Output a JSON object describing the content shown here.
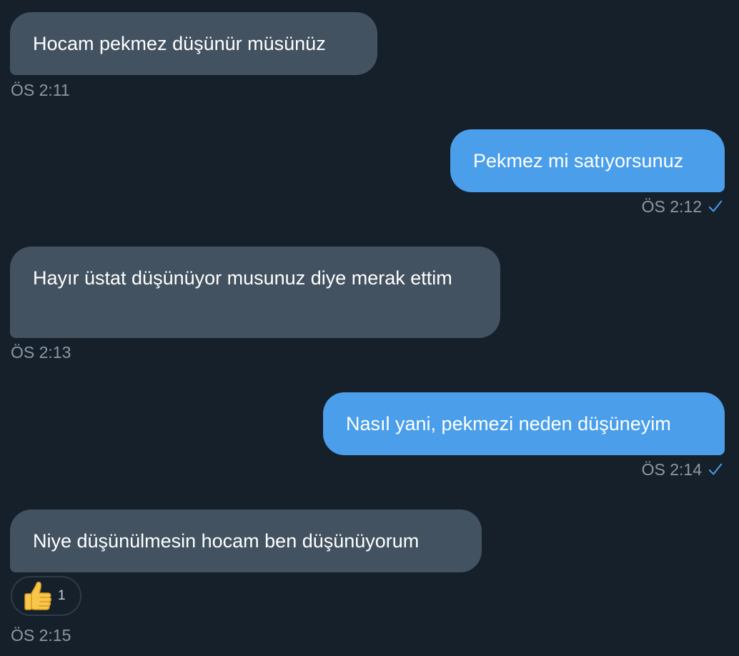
{
  "messages": [
    {
      "direction": "incoming",
      "text": "Hocam pekmez düşünür müsünüz",
      "time": "ÖS 2:11"
    },
    {
      "direction": "outgoing",
      "text": "Pekmez mi satıyorsunuz",
      "time": "ÖS 2:12",
      "status_icon": "check-icon"
    },
    {
      "direction": "incoming",
      "text": "Hayır üstat düşünüyor musunuz diye merak ettim",
      "time": "ÖS 2:13"
    },
    {
      "direction": "outgoing",
      "text": "Nasıl yani, pekmezi neden düşüneyim",
      "time": "ÖS 2:14",
      "status_icon": "check-icon"
    },
    {
      "direction": "incoming",
      "text": "Niye düşünülmesin hocam ben düşünüyorum",
      "time": "ÖS 2:15",
      "reaction": {
        "icon": "thumbs-up-icon",
        "count": "1"
      }
    }
  ],
  "colors": {
    "background": "#15202b",
    "incoming_bubble": "#425260",
    "outgoing_bubble": "#4a9eea",
    "timestamp": "#8b98a5",
    "check": "#4a9eea"
  }
}
